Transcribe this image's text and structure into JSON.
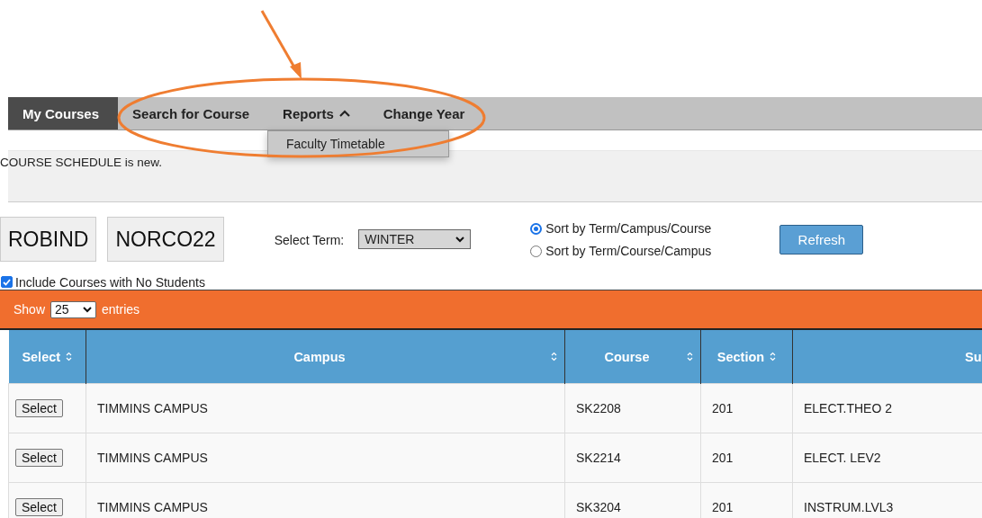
{
  "nav": {
    "items": [
      {
        "label": "My Courses",
        "selected": true
      },
      {
        "label": "Search for Course",
        "selected": false
      },
      {
        "label": "Reports",
        "selected": false,
        "expanded": true
      },
      {
        "label": "Change Year",
        "selected": false
      }
    ],
    "dropdown": [
      "Faculty Timetable"
    ]
  },
  "notice": "COURSE SCHEDULE is new.",
  "codes": [
    "ROBIND",
    "NORCO22"
  ],
  "term": {
    "label": "Select Term:",
    "value": "WINTER"
  },
  "sort_options": [
    {
      "label": "Sort by Term/Campus/Course",
      "selected": true
    },
    {
      "label": "Sort by Term/Course/Campus",
      "selected": false
    }
  ],
  "refresh": "Refresh",
  "include_empty": {
    "label": "Include Courses with No Students",
    "checked": true
  },
  "length": {
    "before": "Show",
    "value": "25",
    "after": "entries"
  },
  "table": {
    "columns": [
      "Select",
      "Campus",
      "Course",
      "Section",
      "Su"
    ],
    "rows": [
      {
        "action": "Select",
        "campus": "TIMMINS CAMPUS",
        "course": "SK2208",
        "section": "201",
        "subject": "ELECT.THEO 2"
      },
      {
        "action": "Select",
        "campus": "TIMMINS CAMPUS",
        "course": "SK2214",
        "section": "201",
        "subject": "ELECT. LEV2"
      },
      {
        "action": "Select",
        "campus": "TIMMINS CAMPUS",
        "course": "SK3204",
        "section": "201",
        "subject": "INSTRUM.LVL3"
      }
    ]
  }
}
